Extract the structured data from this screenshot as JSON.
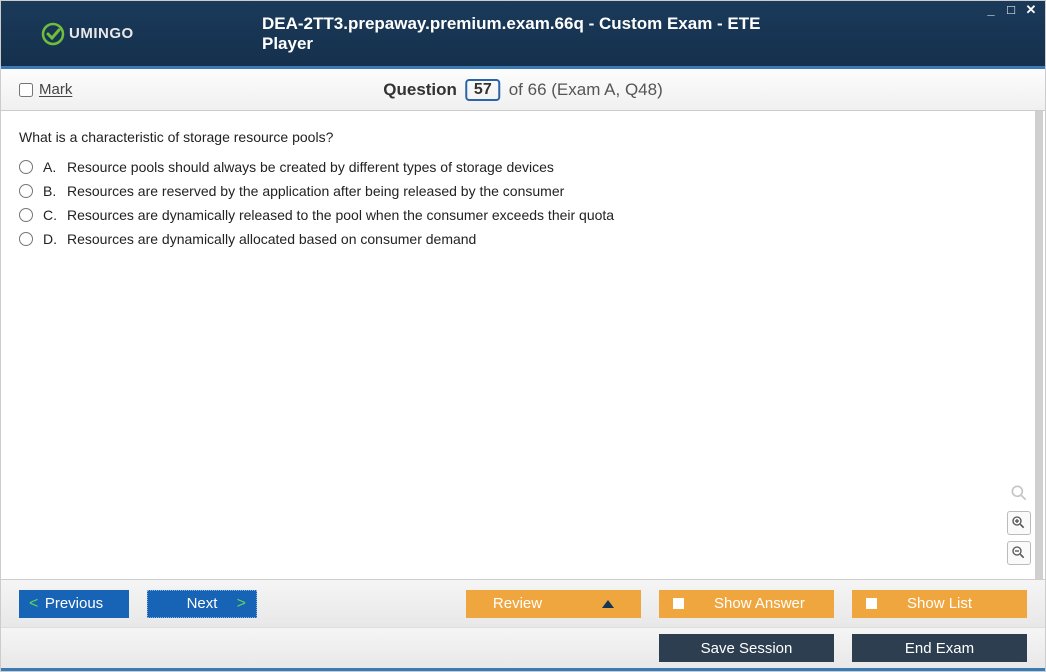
{
  "header": {
    "logo_text": "UMINGO",
    "title": "DEA-2TT3.prepaway.premium.exam.66q - Custom Exam - ETE Player"
  },
  "question_bar": {
    "mark_label": "Mark",
    "question_label": "Question",
    "current": "57",
    "of_total": "of 66 (Exam A, Q48)"
  },
  "question": {
    "text": "What is a characteristic of storage resource pools?",
    "options": [
      {
        "letter": "A.",
        "text": "Resource pools should always be created by different types of storage devices"
      },
      {
        "letter": "B.",
        "text": "Resources are reserved by the application after being released by the consumer"
      },
      {
        "letter": "C.",
        "text": "Resources are dynamically released to the pool when the consumer exceeds their quota"
      },
      {
        "letter": "D.",
        "text": "Resources are dynamically allocated based on consumer demand"
      }
    ]
  },
  "footer": {
    "previous": "Previous",
    "next": "Next",
    "review": "Review",
    "show_answer": "Show Answer",
    "show_list": "Show List",
    "save_session": "Save Session",
    "end_exam": "End Exam"
  }
}
